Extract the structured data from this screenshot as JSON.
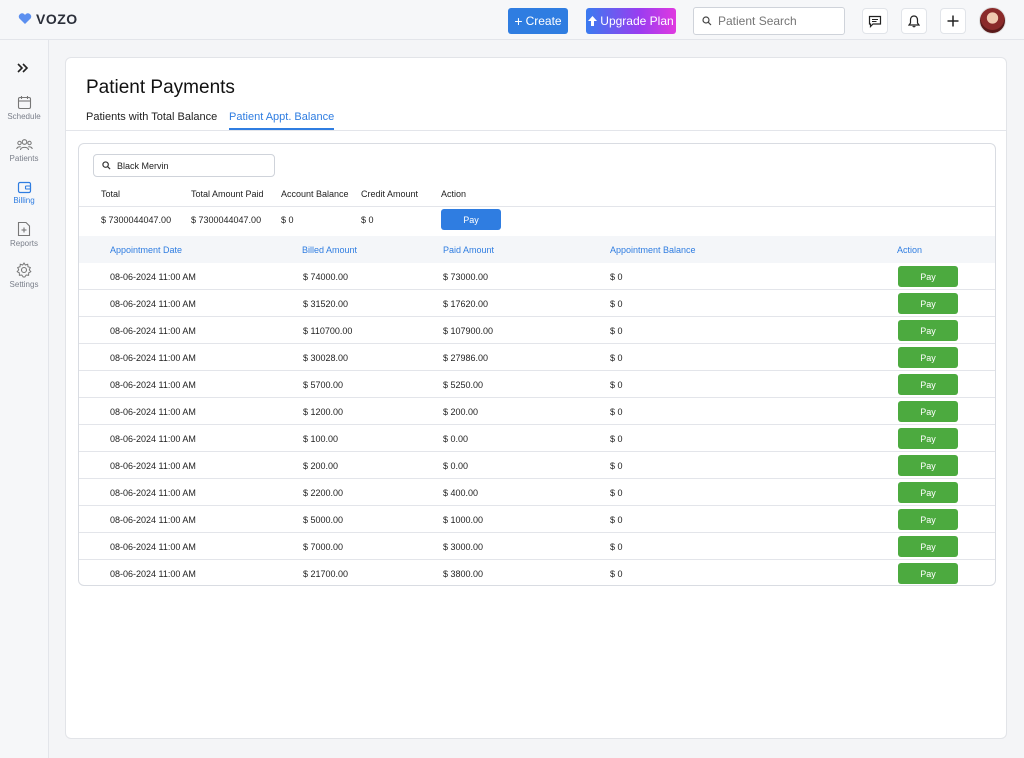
{
  "app": {
    "logo": "VOZO"
  },
  "topbar": {
    "create_label": "Create",
    "upgrade_label": "Upgrade Plan",
    "search_placeholder": "Patient Search"
  },
  "sidebar": {
    "items": [
      {
        "label": "Schedule",
        "icon": "calendar-icon"
      },
      {
        "label": "Patients",
        "icon": "users-icon"
      },
      {
        "label": "Billing",
        "icon": "wallet-icon",
        "active": true
      },
      {
        "label": "Reports",
        "icon": "report-icon"
      },
      {
        "label": "Settings",
        "icon": "gear-icon"
      }
    ]
  },
  "page": {
    "title": "Patient Payments",
    "tabs": [
      {
        "label": "Patients with Total Balance",
        "active": false
      },
      {
        "label": "Patient Appt. Balance",
        "active": true
      }
    ]
  },
  "filter": {
    "patient_name": "Black Mervin"
  },
  "summary": {
    "headers": [
      "Total",
      "Total Amount Paid",
      "Account Balance",
      "Credit Amount",
      "Action"
    ],
    "values": [
      "$ 7300044047.00",
      "$ 7300044047.00",
      "$ 0",
      "$ 0"
    ],
    "pay_label": "Pay"
  },
  "appointments": {
    "headers": [
      "Appointment Date",
      "Billed Amount",
      "Paid Amount",
      "Appointment Balance",
      "Action"
    ],
    "pay_label": "Pay",
    "rows": [
      {
        "date": "08-06-2024 11:00 AM",
        "billed": "$ 74000.00",
        "paid": "$ 73000.00",
        "balance": "$ 0"
      },
      {
        "date": "08-06-2024 11:00 AM",
        "billed": "$ 31520.00",
        "paid": "$ 17620.00",
        "balance": "$ 0"
      },
      {
        "date": "08-06-2024 11:00 AM",
        "billed": "$ 110700.00",
        "paid": "$ 107900.00",
        "balance": "$ 0"
      },
      {
        "date": "08-06-2024 11:00 AM",
        "billed": "$ 30028.00",
        "paid": "$ 27986.00",
        "balance": "$ 0"
      },
      {
        "date": "08-06-2024 11:00 AM",
        "billed": "$ 5700.00",
        "paid": "$ 5250.00",
        "balance": "$ 0"
      },
      {
        "date": "08-06-2024 11:00 AM",
        "billed": "$ 1200.00",
        "paid": "$ 200.00",
        "balance": "$ 0"
      },
      {
        "date": "08-06-2024 11:00 AM",
        "billed": "$ 100.00",
        "paid": "$ 0.00",
        "balance": "$ 0"
      },
      {
        "date": "08-06-2024 11:00 AM",
        "billed": "$ 200.00",
        "paid": "$ 0.00",
        "balance": "$ 0"
      },
      {
        "date": "08-06-2024 11:00 AM",
        "billed": "$ 2200.00",
        "paid": "$ 400.00",
        "balance": "$ 0"
      },
      {
        "date": "08-06-2024 11:00 AM",
        "billed": "$ 5000.00",
        "paid": "$ 1000.00",
        "balance": "$ 0"
      },
      {
        "date": "08-06-2024 11:00 AM",
        "billed": "$ 7000.00",
        "paid": "$ 3000.00",
        "balance": "$ 0"
      },
      {
        "date": "08-06-2024 11:00 AM",
        "billed": "$ 21700.00",
        "paid": "$ 3800.00",
        "balance": "$ 0"
      }
    ]
  },
  "colors": {
    "primary": "#2f7de1",
    "pay_green": "#4caa3f"
  }
}
